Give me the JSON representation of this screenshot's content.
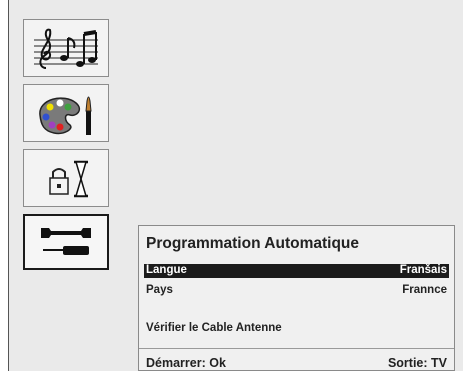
{
  "menu": {
    "tiles": [
      {
        "name": "sound",
        "icon": "music-notes-icon",
        "selected": false
      },
      {
        "name": "picture",
        "icon": "palette-brush-icon",
        "selected": false
      },
      {
        "name": "timer",
        "icon": "lock-hourglass-icon",
        "selected": false
      },
      {
        "name": "setup",
        "icon": "wrench-screwdriver-icon",
        "selected": true
      }
    ]
  },
  "dialog": {
    "title": "Programmation Automatique",
    "rows": [
      {
        "label": "Langue",
        "value": "Franšais",
        "selected": true
      },
      {
        "label": "Pays",
        "value": "Frannce",
        "selected": false
      }
    ],
    "notice": "Vérifier le Cable Antenne",
    "footer": {
      "start_label": "Démarrer: Ok",
      "exit_label": "Sortie: TV"
    }
  },
  "colors": {
    "background": "#eaeaea",
    "selected_row": "#1b1b1b",
    "text": "#222222"
  }
}
